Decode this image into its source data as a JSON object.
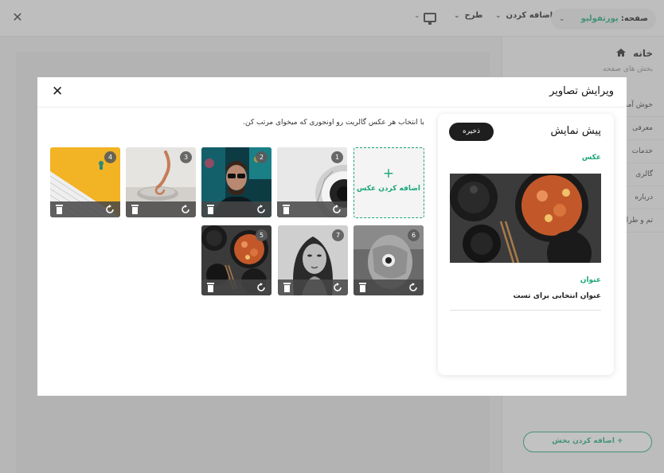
{
  "topbar": {
    "page_label": "صفحه:",
    "page_value": "پورتفولیو",
    "add_menu": "اضافه کردن",
    "design_menu": "طرح"
  },
  "right_panel": {
    "title": "خانه",
    "subtitle": "بخش های صفحه",
    "items": [
      "خوش آمد",
      "معرفی",
      "خدمات",
      "گالری",
      "درباره",
      "تم و طراحی"
    ],
    "add_section": "اضافه کردن بخش"
  },
  "modal": {
    "title": "ویرایش تصاویر",
    "instruction": "با انتخاب هر عکس گالریت رو اونجوری که میخوای مرتب کن.",
    "add_photo": "اضافه کردن عکس",
    "tiles": [
      {
        "number": "1",
        "subject": "spiral-staircase"
      },
      {
        "number": "2",
        "subject": "man-sunglasses-neon"
      },
      {
        "number": "3",
        "subject": "hand-on-sculpture"
      },
      {
        "number": "4",
        "subject": "yellow-stairs"
      },
      {
        "number": "5",
        "subject": "pasta-pans"
      },
      {
        "number": "7",
        "subject": "woman-portrait"
      },
      {
        "number": "6",
        "subject": "hand-over-face"
      }
    ]
  },
  "preview": {
    "title": "پیش نمایش",
    "save": "ذخیره",
    "photo_label": "عکس",
    "caption_label": "عنوان",
    "caption_value": "عنوان انتخابی برای تست"
  },
  "colors": {
    "accent": "#1aa67a",
    "dark_button": "#1e1e1e"
  }
}
